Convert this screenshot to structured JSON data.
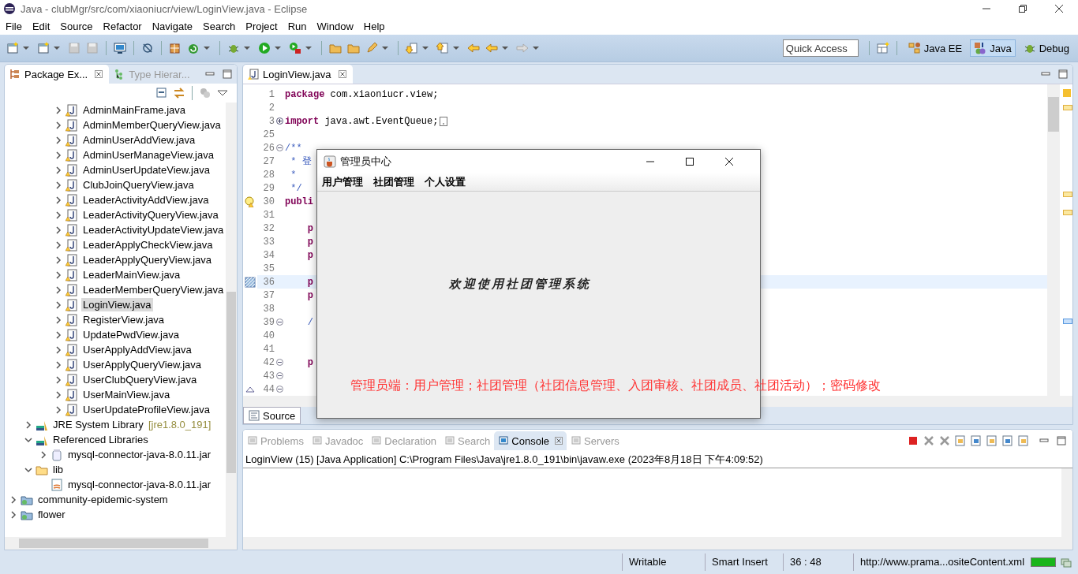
{
  "window": {
    "title": "Java - clubMgr/src/com/xiaoniucr/view/LoginView.java - Eclipse"
  },
  "menu": [
    "File",
    "Edit",
    "Source",
    "Refactor",
    "Navigate",
    "Search",
    "Project",
    "Run",
    "Window",
    "Help"
  ],
  "quick_access": {
    "placeholder": "Quick Access"
  },
  "perspectives": [
    {
      "label": "Java EE",
      "kind": "javaee",
      "selected": false
    },
    {
      "label": "Java",
      "kind": "java",
      "selected": true
    },
    {
      "label": "Debug",
      "kind": "debug",
      "selected": false
    }
  ],
  "explorer": {
    "tabs": [
      {
        "label": "Package Ex...",
        "kind": "package",
        "selected": true
      },
      {
        "label": "Type Hierar...",
        "kind": "hierarchy",
        "selected": false
      }
    ],
    "tree": [
      {
        "children": [
          {
            "children": [
              {
                "children": [
                  {
                    "label": "AdminMainFrame.java",
                    "kind": "java",
                    "expanded": false,
                    "selected": false
                  },
                  {
                    "label": "AdminMemberQueryView.java",
                    "kind": "java",
                    "expanded": false,
                    "selected": false
                  },
                  {
                    "label": "AdminUserAddView.java",
                    "kind": "java",
                    "expanded": false,
                    "selected": false
                  },
                  {
                    "label": "AdminUserManageView.java",
                    "kind": "java",
                    "expanded": false,
                    "selected": false
                  },
                  {
                    "label": "AdminUserUpdateView.java",
                    "kind": "java",
                    "expanded": false,
                    "selected": false
                  },
                  {
                    "label": "ClubJoinQueryView.java",
                    "kind": "java",
                    "expanded": false,
                    "selected": false
                  },
                  {
                    "label": "LeaderActivityAddView.java",
                    "kind": "java",
                    "expanded": false,
                    "selected": false
                  },
                  {
                    "label": "LeaderActivityQueryView.java",
                    "kind": "java",
                    "expanded": false,
                    "selected": false
                  },
                  {
                    "label": "LeaderActivityUpdateView.java",
                    "kind": "java",
                    "expanded": false,
                    "selected": false
                  },
                  {
                    "label": "LeaderApplyCheckView.java",
                    "kind": "java",
                    "expanded": false,
                    "selected": false
                  },
                  {
                    "label": "LeaderApplyQueryView.java",
                    "kind": "java",
                    "expanded": false,
                    "selected": false
                  },
                  {
                    "label": "LeaderMainView.java",
                    "kind": "java",
                    "expanded": false,
                    "selected": false
                  },
                  {
                    "label": "LeaderMemberQueryView.java",
                    "kind": "java",
                    "expanded": false,
                    "selected": false
                  },
                  {
                    "label": "LoginView.java",
                    "kind": "java",
                    "expanded": false,
                    "selected": true
                  },
                  {
                    "label": "RegisterView.java",
                    "kind": "java",
                    "expanded": false,
                    "selected": false
                  },
                  {
                    "label": "UpdatePwdView.java",
                    "kind": "java",
                    "expanded": false,
                    "selected": false
                  },
                  {
                    "label": "UserApplyAddView.java",
                    "kind": "java",
                    "expanded": false,
                    "selected": false
                  },
                  {
                    "label": "UserApplyQueryView.java",
                    "kind": "java",
                    "expanded": false,
                    "selected": false
                  },
                  {
                    "label": "UserClubQueryView.java",
                    "kind": "java",
                    "expanded": false,
                    "selected": false
                  },
                  {
                    "label": "UserMainView.java",
                    "kind": "java",
                    "expanded": false,
                    "selected": false
                  },
                  {
                    "label": "UserUpdateProfileView.java",
                    "kind": "java",
                    "expanded": false,
                    "selected": false
                  }
                ]
              }
            ]
          },
          {
            "label": "JRE System Library",
            "decoration": "[jre1.8.0_191]",
            "kind": "library",
            "expanded": false,
            "selected": false
          },
          {
            "label": "Referenced Libraries",
            "kind": "library",
            "expanded": true,
            "selected": false,
            "children": [
              {
                "label": "mysql-connector-java-8.0.11.jar",
                "kind": "jar",
                "expanded": false,
                "selected": false
              }
            ]
          },
          {
            "label": "lib",
            "kind": "folder",
            "expanded": true,
            "selected": false,
            "children": [
              {
                "label": "mysql-connector-java-8.0.11.jar",
                "kind": "jarfile",
                "selected": false
              }
            ]
          }
        ]
      },
      {
        "label": "community-epidemic-system",
        "kind": "project",
        "expanded": false,
        "selected": false
      },
      {
        "label": "flower",
        "kind": "project",
        "expanded": false,
        "selected": false
      }
    ]
  },
  "editor": {
    "tabs": [
      {
        "label": "LoginView.java",
        "selected": true
      }
    ],
    "lines": [
      {
        "number": "1",
        "kind": "plain",
        "tokens": [
          {
            "text": "package",
            "kind": "keyword"
          },
          {
            "text": " com.xiaoniucr.view;",
            "kind": "plain"
          }
        ]
      },
      {
        "number": "2",
        "kind": "plain"
      },
      {
        "number": "3",
        "kind": "folded",
        "tokens": [
          {
            "text": "import",
            "kind": "keyword"
          },
          {
            "text": " java.awt.EventQueue;",
            "kind": "plain"
          }
        ]
      },
      {
        "number": "25",
        "kind": "plain"
      },
      {
        "number": "26",
        "kind": "fold",
        "tokens": [
          {
            "text": "/**",
            "kind": "comment"
          }
        ]
      },
      {
        "number": "27",
        "kind": "plain",
        "tokens": [
          {
            "text": " * 登",
            "kind": "comment"
          }
        ]
      },
      {
        "number": "28",
        "kind": "plain",
        "tokens": [
          {
            "text": " *",
            "kind": "comment"
          }
        ]
      },
      {
        "number": "29",
        "kind": "plain",
        "tokens": [
          {
            "text": " */",
            "kind": "comment"
          }
        ]
      },
      {
        "number": "30",
        "kind": "warning",
        "tokens": [
          {
            "text": "publi",
            "kind": "keyword"
          }
        ]
      },
      {
        "number": "31",
        "kind": "plain"
      },
      {
        "number": "32",
        "kind": "plain",
        "tokens": [
          {
            "text": "    p",
            "kind": "keyword"
          }
        ]
      },
      {
        "number": "33",
        "kind": "plain",
        "tokens": [
          {
            "text": "    p",
            "kind": "keyword"
          }
        ]
      },
      {
        "number": "34",
        "kind": "plain",
        "tokens": [
          {
            "text": "    p",
            "kind": "keyword"
          }
        ]
      },
      {
        "number": "35",
        "kind": "plain"
      },
      {
        "number": "36",
        "kind": "current",
        "tokens": [
          {
            "text": "    p",
            "kind": "keyword"
          }
        ]
      },
      {
        "number": "37",
        "kind": "plain",
        "tokens": [
          {
            "text": "    p",
            "kind": "keyword"
          }
        ]
      },
      {
        "number": "38",
        "kind": "plain"
      },
      {
        "number": "39",
        "kind": "fold",
        "tokens": [
          {
            "text": "    /",
            "kind": "comment"
          }
        ]
      },
      {
        "number": "40",
        "kind": "plain"
      },
      {
        "number": "41",
        "kind": "plain"
      },
      {
        "number": "42",
        "kind": "fold",
        "tokens": [
          {
            "text": "    p",
            "kind": "keyword"
          }
        ]
      },
      {
        "number": "43",
        "kind": "fold"
      },
      {
        "number": "44",
        "kind": "override"
      }
    ],
    "bottom_tabs": [
      {
        "label": "Source",
        "selected": true
      }
    ]
  },
  "dialog": {
    "title": "管理员中心",
    "menu": [
      "用户管理",
      "社团管理",
      "个人设置"
    ],
    "welcome": "欢迎使用社团管理系统"
  },
  "note": "管理员端：用户管理；社团管理（社团信息管理、入团审核、社团成员、社团活动）；密码修改",
  "console": {
    "tabs": [
      {
        "label": "Problems",
        "selected": false
      },
      {
        "label": "Javadoc",
        "selected": false
      },
      {
        "label": "Declaration",
        "selected": false
      },
      {
        "label": "Search",
        "selected": false
      },
      {
        "label": "Console",
        "selected": true
      },
      {
        "label": "Servers",
        "selected": false
      }
    ],
    "header": "LoginView (15) [Java Application] C:\\Program Files\\Java\\jre1.8.0_191\\bin\\javaw.exe (2023年8月18日 下午4:09:52)"
  },
  "status_bar": {
    "mode": "Writable",
    "insert": "Smart Insert",
    "position": "36 : 48",
    "job": "http://www.prama...ositeContent.xml"
  }
}
